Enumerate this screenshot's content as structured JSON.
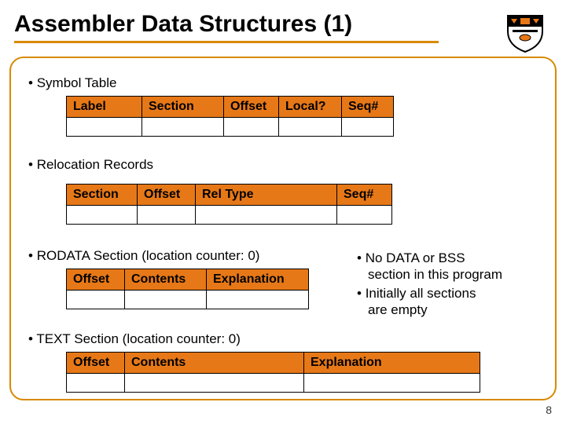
{
  "title": "Assembler Data Structures (1)",
  "bullets": [
    "Symbol Table",
    "Relocation Records",
    "RODATA Section (location counter: 0)",
    "TEXT Section (location counter: 0)"
  ],
  "tables": {
    "symbol": [
      "Label",
      "Section",
      "Offset",
      "Local?",
      "Seq#"
    ],
    "relocation": [
      "Section",
      "Offset",
      "Rel Type",
      "Seq#"
    ],
    "rodata": [
      "Offset",
      "Contents",
      "Explanation"
    ],
    "text": [
      "Offset",
      "Contents",
      "Explanation"
    ]
  },
  "sidenote": [
    "No DATA or BSS",
    "section in this program",
    "Initially all sections",
    "are empty"
  ],
  "page": "8",
  "colors": {
    "accent": "#e77817",
    "frame": "#d88a00"
  }
}
